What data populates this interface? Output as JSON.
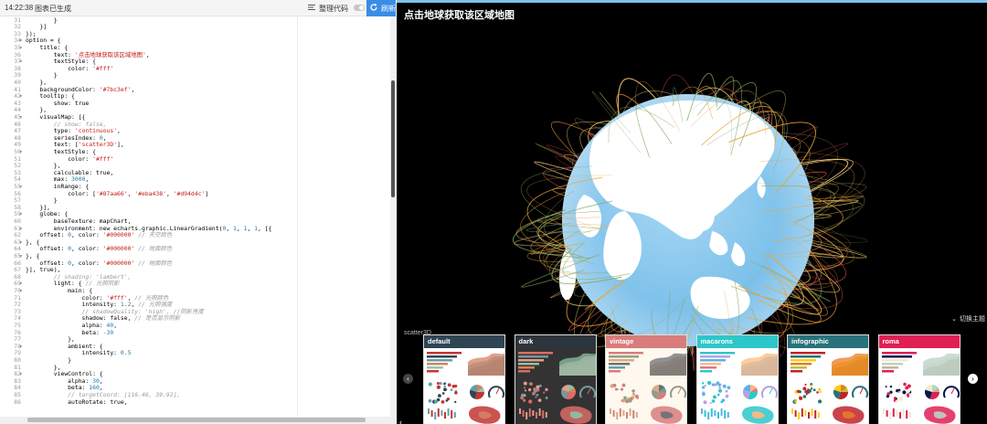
{
  "topbar": {
    "time": "14:22:38",
    "status": "图表已生成",
    "format_label": "整理代码",
    "refresh_label": "刷新"
  },
  "code_lines": [
    {
      "n": "31",
      "fold": "",
      "t": [
        [
          "k",
          "        }"
        ]
      ]
    },
    {
      "n": "32",
      "fold": "",
      "t": [
        [
          "k",
          "    }]"
        ]
      ]
    },
    {
      "n": "33",
      "fold": "",
      "t": [
        [
          "k",
          "});"
        ]
      ]
    },
    {
      "n": "34",
      "fold": "▾",
      "t": [
        [
          "k",
          "option = {"
        ]
      ]
    },
    {
      "n": "35",
      "fold": "▾",
      "t": [
        [
          "k",
          "    title: {"
        ]
      ]
    },
    {
      "n": "36",
      "fold": "",
      "t": [
        [
          "k",
          "        text: "
        ],
        [
          "s",
          "'点击地球获取该区域地图'"
        ],
        [
          "k",
          ","
        ]
      ]
    },
    {
      "n": "37",
      "fold": "▾",
      "t": [
        [
          "k",
          "        textStyle: {"
        ]
      ]
    },
    {
      "n": "38",
      "fold": "",
      "t": [
        [
          "k",
          "            color: "
        ],
        [
          "s",
          "'#fff'"
        ]
      ]
    },
    {
      "n": "39",
      "fold": "",
      "t": [
        [
          "k",
          "        }"
        ]
      ]
    },
    {
      "n": "40",
      "fold": "",
      "t": [
        [
          "k",
          "    },"
        ]
      ]
    },
    {
      "n": "41",
      "fold": "",
      "t": [
        [
          "k",
          "    backgroundColor: "
        ],
        [
          "s",
          "'#7bc3ef'"
        ],
        [
          "k",
          ","
        ]
      ]
    },
    {
      "n": "42",
      "fold": "▾",
      "t": [
        [
          "k",
          "    tooltip: {"
        ]
      ]
    },
    {
      "n": "43",
      "fold": "",
      "t": [
        [
          "k",
          "        show: true"
        ]
      ]
    },
    {
      "n": "44",
      "fold": "",
      "t": [
        [
          "k",
          "    },"
        ]
      ]
    },
    {
      "n": "45",
      "fold": "▾",
      "t": [
        [
          "k",
          "    visualMap: [{"
        ]
      ]
    },
    {
      "n": "46",
      "fold": "",
      "t": [
        [
          "c",
          "        // show: false,"
        ]
      ]
    },
    {
      "n": "47",
      "fold": "",
      "t": [
        [
          "k",
          "        type: "
        ],
        [
          "s",
          "'continuous'"
        ],
        [
          "k",
          ","
        ]
      ]
    },
    {
      "n": "48",
      "fold": "",
      "t": [
        [
          "k",
          "        seriesIndex: "
        ],
        [
          "n",
          "0"
        ],
        [
          "k",
          ","
        ]
      ]
    },
    {
      "n": "49",
      "fold": "",
      "t": [
        [
          "k",
          "        text: ["
        ],
        [
          "s",
          "'scatter3D'"
        ],
        [
          "k",
          "],"
        ]
      ]
    },
    {
      "n": "50",
      "fold": "▾",
      "t": [
        [
          "k",
          "        textStyle: {"
        ]
      ]
    },
    {
      "n": "51",
      "fold": "",
      "t": [
        [
          "k",
          "            color: "
        ],
        [
          "s",
          "'#fff'"
        ]
      ]
    },
    {
      "n": "52",
      "fold": "",
      "t": [
        [
          "k",
          "        },"
        ]
      ]
    },
    {
      "n": "53",
      "fold": "",
      "t": [
        [
          "k",
          "        calculable: true,"
        ]
      ]
    },
    {
      "n": "54",
      "fold": "",
      "t": [
        [
          "k",
          "        max: "
        ],
        [
          "n",
          "3000"
        ],
        [
          "k",
          ","
        ]
      ]
    },
    {
      "n": "55",
      "fold": "▾",
      "t": [
        [
          "k",
          "        inRange: {"
        ]
      ]
    },
    {
      "n": "56",
      "fold": "",
      "t": [
        [
          "k",
          "            color: ["
        ],
        [
          "s",
          "'#87aa66'"
        ],
        [
          "k",
          ", "
        ],
        [
          "s",
          "'#eba438'"
        ],
        [
          "k",
          ", "
        ],
        [
          "s",
          "'#d94d4c'"
        ],
        [
          "k",
          "]"
        ]
      ]
    },
    {
      "n": "57",
      "fold": "",
      "t": [
        [
          "k",
          "        }"
        ]
      ]
    },
    {
      "n": "58",
      "fold": "",
      "t": [
        [
          "k",
          "    }],"
        ]
      ]
    },
    {
      "n": "59",
      "fold": "▾",
      "t": [
        [
          "k",
          "    globe: {"
        ]
      ]
    },
    {
      "n": "60",
      "fold": "",
      "t": [
        [
          "k",
          "        baseTexture: mapChart,"
        ]
      ]
    },
    {
      "n": "61",
      "fold": "▾",
      "t": [
        [
          "k",
          "        environment: new echarts.graphic.LinearGradient("
        ],
        [
          "n",
          "0"
        ],
        [
          "k",
          ", "
        ],
        [
          "n",
          "1"
        ],
        [
          "k",
          ", "
        ],
        [
          "n",
          "1"
        ],
        [
          "k",
          ", "
        ],
        [
          "n",
          "1"
        ],
        [
          "k",
          ", [{"
        ]
      ]
    },
    {
      "n": "62",
      "fold": "",
      "t": [
        [
          "k",
          "    offset: "
        ],
        [
          "n",
          "0"
        ],
        [
          "k",
          ", color: "
        ],
        [
          "s",
          "'#000000'"
        ],
        [
          "c",
          " // 天空颜色"
        ]
      ]
    },
    {
      "n": "63",
      "fold": "▾",
      "t": [
        [
          "k",
          "}, {"
        ]
      ]
    },
    {
      "n": "64",
      "fold": "",
      "t": [
        [
          "k",
          "    offset: "
        ],
        [
          "n",
          "0"
        ],
        [
          "k",
          ", color: "
        ],
        [
          "s",
          "'#000000'"
        ],
        [
          "c",
          " // 地面颜色"
        ]
      ]
    },
    {
      "n": "65",
      "fold": "▾",
      "t": [
        [
          "k",
          "}, {"
        ]
      ]
    },
    {
      "n": "66",
      "fold": "",
      "t": [
        [
          "k",
          "    offset: "
        ],
        [
          "n",
          "0"
        ],
        [
          "k",
          ", color: "
        ],
        [
          "s",
          "'#000000'"
        ],
        [
          "c",
          " // 地面颜色"
        ]
      ]
    },
    {
      "n": "67",
      "fold": "",
      "t": [
        [
          "k",
          "}], true),"
        ]
      ]
    },
    {
      "n": "68",
      "fold": "",
      "t": [
        [
          "c",
          "        // shading: 'lambert',"
        ]
      ]
    },
    {
      "n": "69",
      "fold": "▾",
      "t": [
        [
          "k",
          "        light: { "
        ],
        [
          "c",
          "// 光照阴影"
        ]
      ]
    },
    {
      "n": "70",
      "fold": "▾",
      "t": [
        [
          "k",
          "            main: {"
        ]
      ]
    },
    {
      "n": "71",
      "fold": "",
      "t": [
        [
          "k",
          "                color: "
        ],
        [
          "s",
          "'#fff'"
        ],
        [
          "k",
          ", "
        ],
        [
          "c",
          "// 光照颜色"
        ]
      ]
    },
    {
      "n": "72",
      "fold": "",
      "t": [
        [
          "k",
          "                intensity: "
        ],
        [
          "n",
          "1.2"
        ],
        [
          "k",
          ", "
        ],
        [
          "c",
          "// 光照强度"
        ]
      ]
    },
    {
      "n": "73",
      "fold": "",
      "t": [
        [
          "c",
          "                // shadowQuality: 'high', //阴影亮度"
        ]
      ]
    },
    {
      "n": "74",
      "fold": "",
      "t": [
        [
          "k",
          "                shadow: false, "
        ],
        [
          "c",
          "// 是否显示阴影"
        ]
      ]
    },
    {
      "n": "75",
      "fold": "",
      "t": [
        [
          "k",
          "                alpha: "
        ],
        [
          "n",
          "40"
        ],
        [
          "k",
          ","
        ]
      ]
    },
    {
      "n": "76",
      "fold": "",
      "t": [
        [
          "k",
          "                beta: "
        ],
        [
          "n",
          "-30"
        ]
      ]
    },
    {
      "n": "77",
      "fold": "",
      "t": [
        [
          "k",
          "            },"
        ]
      ]
    },
    {
      "n": "78",
      "fold": "▾",
      "t": [
        [
          "k",
          "            ambient: {"
        ]
      ]
    },
    {
      "n": "79",
      "fold": "",
      "t": [
        [
          "k",
          "                intensity: "
        ],
        [
          "n",
          "0.5"
        ]
      ]
    },
    {
      "n": "80",
      "fold": "",
      "t": [
        [
          "k",
          "            }"
        ]
      ]
    },
    {
      "n": "81",
      "fold": "",
      "t": [
        [
          "k",
          "        },"
        ]
      ]
    },
    {
      "n": "82",
      "fold": "▾",
      "t": [
        [
          "k",
          "        viewControl: {"
        ]
      ]
    },
    {
      "n": "83",
      "fold": "",
      "t": [
        [
          "k",
          "            alpha: "
        ],
        [
          "n",
          "30"
        ],
        [
          "k",
          ","
        ]
      ]
    },
    {
      "n": "84",
      "fold": "",
      "t": [
        [
          "k",
          "            beta: "
        ],
        [
          "n",
          "160"
        ],
        [
          "k",
          ","
        ]
      ]
    },
    {
      "n": "85",
      "fold": "",
      "t": [
        [
          "c",
          "            // targetCoord: [116.46, 39.92],"
        ]
      ]
    },
    {
      "n": "86",
      "fold": "",
      "t": [
        [
          "k",
          "            autoRotate: true,"
        ]
      ]
    }
  ],
  "preview": {
    "title": "点击地球获取该区域地图",
    "visualmap_label": "scatter3D",
    "theme_toggle_label": "切换主题"
  },
  "themes": [
    {
      "name": "default",
      "header": "#2f4554",
      "bg": "#ffffff",
      "palette": [
        "#c23531",
        "#2f4554",
        "#61a0a8",
        "#d48265",
        "#91c7ae"
      ]
    },
    {
      "name": "dark",
      "header": "#2c343c",
      "bg": "#333333",
      "palette": [
        "#dd6b66",
        "#759aa0",
        "#e69d87",
        "#8dc1a9",
        "#ea7e53"
      ]
    },
    {
      "name": "vintage",
      "header": "#d87c7c",
      "bg": "#fef8ef",
      "palette": [
        "#d87c7c",
        "#919e8b",
        "#d7ab82",
        "#6e7074",
        "#61a0a8"
      ]
    },
    {
      "name": "macarons",
      "header": "#2ec7c9",
      "bg": "#ffffff",
      "palette": [
        "#2ec7c9",
        "#b6a2de",
        "#5ab1ef",
        "#ffb980",
        "#d87a80"
      ]
    },
    {
      "name": "infographic",
      "header": "#27727b",
      "bg": "#ffffff",
      "palette": [
        "#c1232b",
        "#27727b",
        "#fcce10",
        "#e87c25",
        "#b5c334"
      ]
    },
    {
      "name": "roma",
      "header": "#e01f54",
      "bg": "#ffffff",
      "palette": [
        "#e01f54",
        "#001852",
        "#f5e8c8",
        "#b8d2c7",
        "#c6b38e"
      ]
    }
  ]
}
